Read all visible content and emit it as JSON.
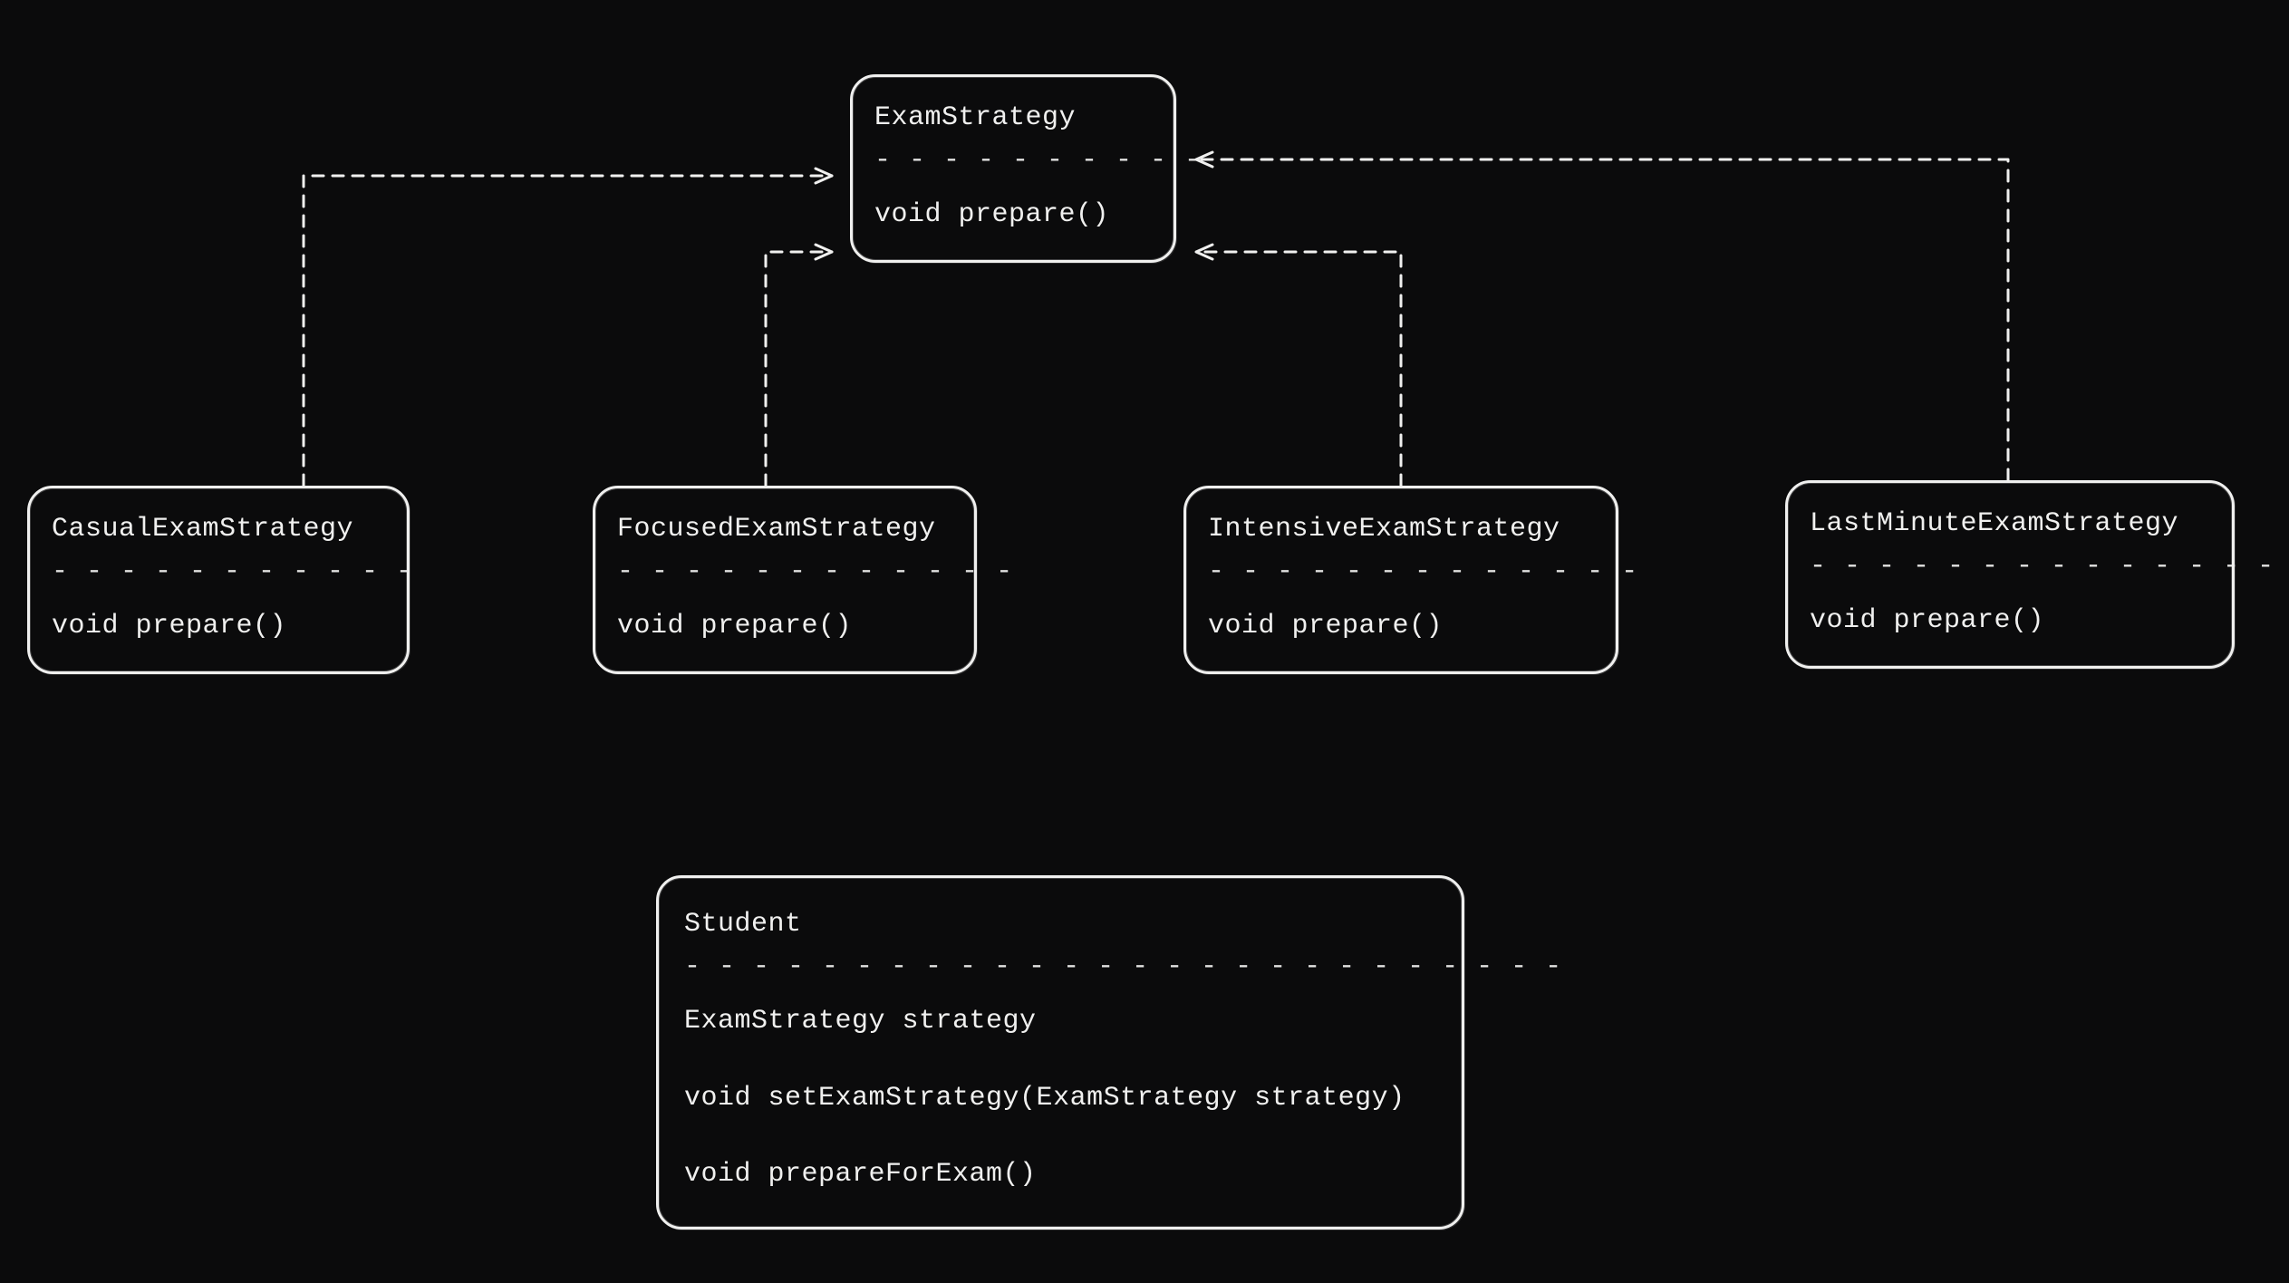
{
  "nodes": {
    "interface": {
      "name": "ExamStrategy",
      "divider": "- - - - - - - - - -",
      "method": "void prepare()"
    },
    "casual": {
      "name": "CasualExamStrategy",
      "divider": "- - - - - - - - - - -",
      "method": "void prepare()"
    },
    "focused": {
      "name": "FocusedExamStrategy",
      "divider": "- - - - - - - - - - - -",
      "method": "void prepare()"
    },
    "intensive": {
      "name": "IntensiveExamStrategy",
      "divider": "- - - - - - - - - - - - -",
      "method": "void prepare()"
    },
    "lastminute": {
      "name": "LastMinuteExamStrategy",
      "divider": "- - - - - - - - - - - - - -",
      "method": "void prepare()"
    },
    "student": {
      "name": "Student",
      "divider": "- - - - - - - - - - - - - - - - - - - - - - - - - -",
      "field": "ExamStrategy strategy",
      "method1": "void setExamStrategy(ExamStrategy strategy)",
      "method2": "void prepareForExam()"
    }
  }
}
